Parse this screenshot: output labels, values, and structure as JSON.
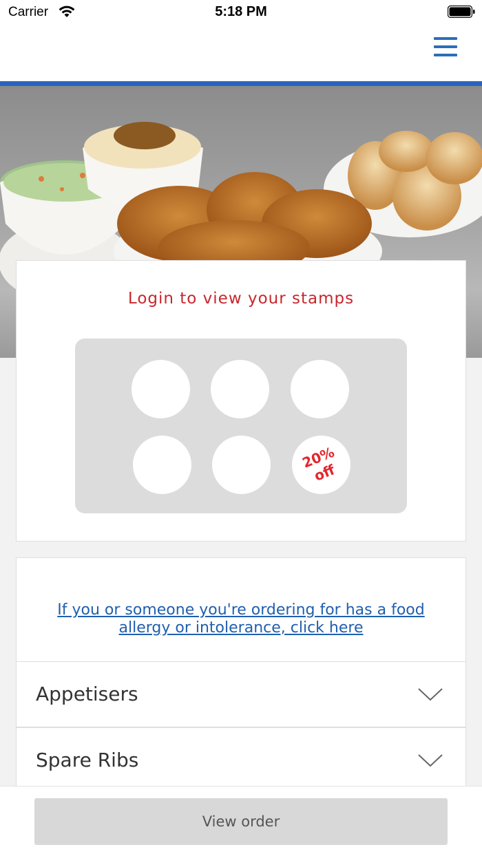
{
  "status_bar": {
    "carrier": "Carrier",
    "time": "5:18 PM"
  },
  "header": {
    "menu_icon": "hamburger-menu-icon",
    "accent_color": "#2a63c0"
  },
  "stamps": {
    "title": "Login to view your stamps",
    "stamp_count": 6,
    "reward_text": "20% off",
    "reward_line1": "20%",
    "reward_line2": "off",
    "title_color": "#c8262c"
  },
  "allergy": {
    "link_text": "If you or someone you're ordering for has a food allergy or intolerance, click here"
  },
  "categories": [
    {
      "label": "Appetisers",
      "icon": "chevron-down-icon"
    },
    {
      "label": "Spare Ribs",
      "icon": "chevron-down-icon"
    }
  ],
  "footer": {
    "view_order_label": "View order"
  }
}
